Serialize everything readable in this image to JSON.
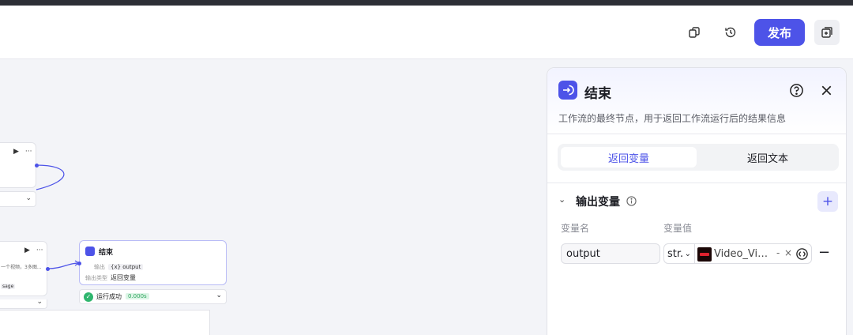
{
  "header": {
    "publish_label": "发布"
  },
  "canvas": {
    "end_node": {
      "title": "结束",
      "output_label": "输出",
      "output_tag": "{x} output",
      "output_type_label": "输出类型",
      "output_type_value": "返回变量"
    },
    "run_status": {
      "text": "运行成功",
      "time": "0.000s"
    },
    "prev_node": {
      "snippet": "一个视频，3多图...",
      "tag": "sage"
    }
  },
  "panel": {
    "title": "结束",
    "description": "工作流的最终节点，用于返回工作流运行后的结果信息",
    "tabs": [
      {
        "label": "返回变量",
        "active": true
      },
      {
        "label": "返回文本",
        "active": false
      }
    ],
    "section": {
      "title": "输出变量",
      "col_name": "变量名",
      "col_value": "变量值",
      "row": {
        "name": "output",
        "type": "str.",
        "value": "Video_Video...",
        "dash": "-",
        "remove": "×"
      }
    }
  },
  "colors": {
    "accent": "#4d53e8",
    "success": "#2fb66e"
  }
}
